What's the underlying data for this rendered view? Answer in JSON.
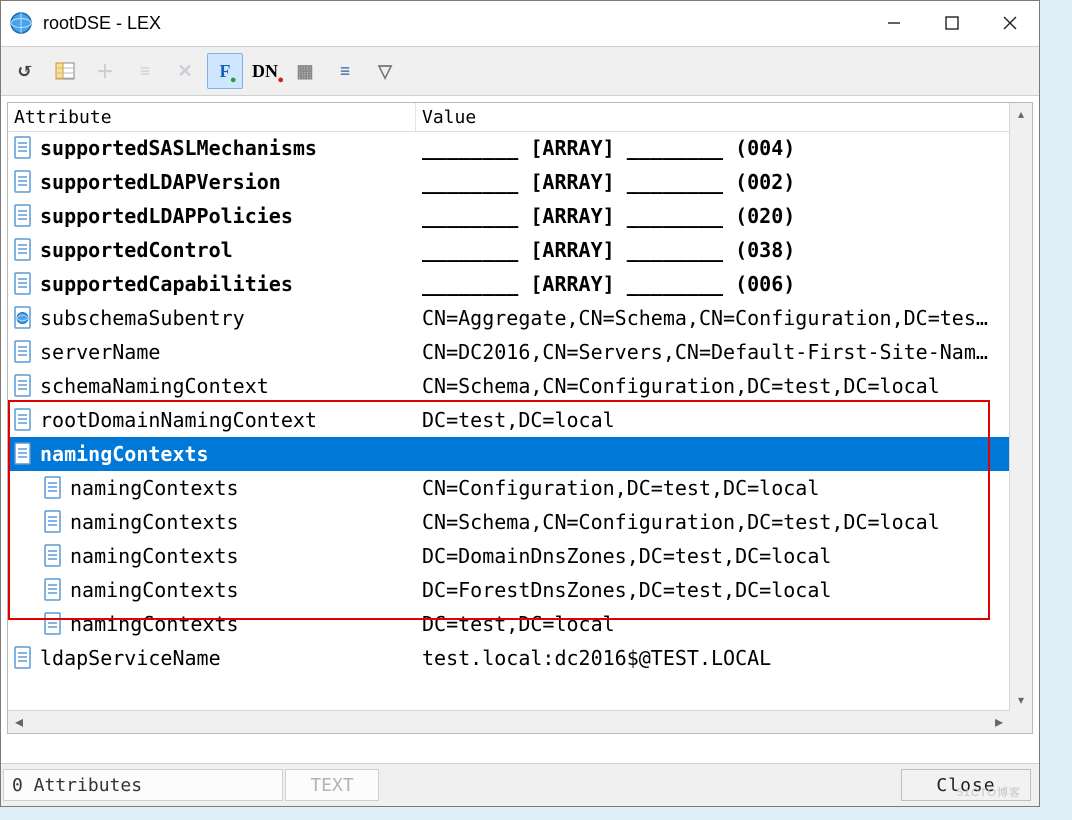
{
  "window": {
    "title": "rootDSE - LEX"
  },
  "toolbar": {
    "items": [
      {
        "name": "refresh-icon",
        "glyph": "↺",
        "color": "#444"
      },
      {
        "name": "fields-icon",
        "glyph": "",
        "color": "#444"
      },
      {
        "name": "add-icon",
        "glyph": "＋",
        "color": "#9aa9b6",
        "disabled": true
      },
      {
        "name": "remove-icon",
        "glyph": "≡",
        "color": "#9aa9b6",
        "disabled": true
      },
      {
        "name": "delete-icon",
        "glyph": "✕",
        "color": "#9aa9b6",
        "disabled": true
      },
      {
        "name": "friendly-name-icon",
        "glyph": "F",
        "color": "#1a5fb4",
        "active": true,
        "badge": "●",
        "badgeColor": "#2e9e2e"
      },
      {
        "name": "dn-icon",
        "glyph": "DN",
        "color": "#000",
        "badge": "●",
        "badgeColor": "#d21f1f"
      },
      {
        "name": "options-icon",
        "glyph": "▦",
        "color": "#888"
      },
      {
        "name": "sort-icon",
        "glyph": "≡",
        "color": "#2a5fa0"
      },
      {
        "name": "filter-icon",
        "glyph": "▽",
        "color": "#777"
      }
    ]
  },
  "columns": {
    "attribute": "Attribute",
    "value": "Value"
  },
  "rows": [
    {
      "icon": "doc",
      "bold": true,
      "attr": "supportedSASLMechanisms",
      "val": "________ [ARRAY] ________ (004)"
    },
    {
      "icon": "doc",
      "bold": true,
      "attr": "supportedLDAPVersion",
      "val": "________ [ARRAY] ________ (002)"
    },
    {
      "icon": "doc",
      "bold": true,
      "attr": "supportedLDAPPolicies",
      "val": "________ [ARRAY] ________ (020)"
    },
    {
      "icon": "doc",
      "bold": true,
      "attr": "supportedControl",
      "val": "________ [ARRAY] ________ (038)"
    },
    {
      "icon": "doc",
      "bold": true,
      "attr": "supportedCapabilities",
      "val": "________ [ARRAY] ________ (006)"
    },
    {
      "icon": "globe",
      "attr": "subschemaSubentry",
      "val": "CN=Aggregate,CN=Schema,CN=Configuration,DC=tes…"
    },
    {
      "icon": "doc",
      "attr": "serverName",
      "val": "CN=DC2016,CN=Servers,CN=Default-First-Site-Nam…"
    },
    {
      "icon": "doc",
      "attr": "schemaNamingContext",
      "val": "CN=Schema,CN=Configuration,DC=test,DC=local"
    },
    {
      "icon": "doc",
      "attr": "rootDomainNamingContext",
      "val": "DC=test,DC=local"
    },
    {
      "icon": "doc",
      "bold": true,
      "selected": true,
      "attr": "namingContexts",
      "val": ""
    },
    {
      "icon": "doc",
      "child": true,
      "attr": "namingContexts",
      "val": "CN=Configuration,DC=test,DC=local"
    },
    {
      "icon": "doc",
      "child": true,
      "attr": "namingContexts",
      "val": "CN=Schema,CN=Configuration,DC=test,DC=local"
    },
    {
      "icon": "doc",
      "child": true,
      "attr": "namingContexts",
      "val": "DC=DomainDnsZones,DC=test,DC=local"
    },
    {
      "icon": "doc",
      "child": true,
      "attr": "namingContexts",
      "val": "DC=ForestDnsZones,DC=test,DC=local"
    },
    {
      "icon": "doc",
      "child": true,
      "attr": "namingContexts",
      "val": "DC=test,DC=local"
    },
    {
      "icon": "doc",
      "attr": "ldapServiceName",
      "val": "test.local:dc2016$@TEST.LOCAL"
    }
  ],
  "statusbar": {
    "attributes": "0 Attributes",
    "mode": "TEXT",
    "close": "Close"
  },
  "watermark": "51CTO博客"
}
